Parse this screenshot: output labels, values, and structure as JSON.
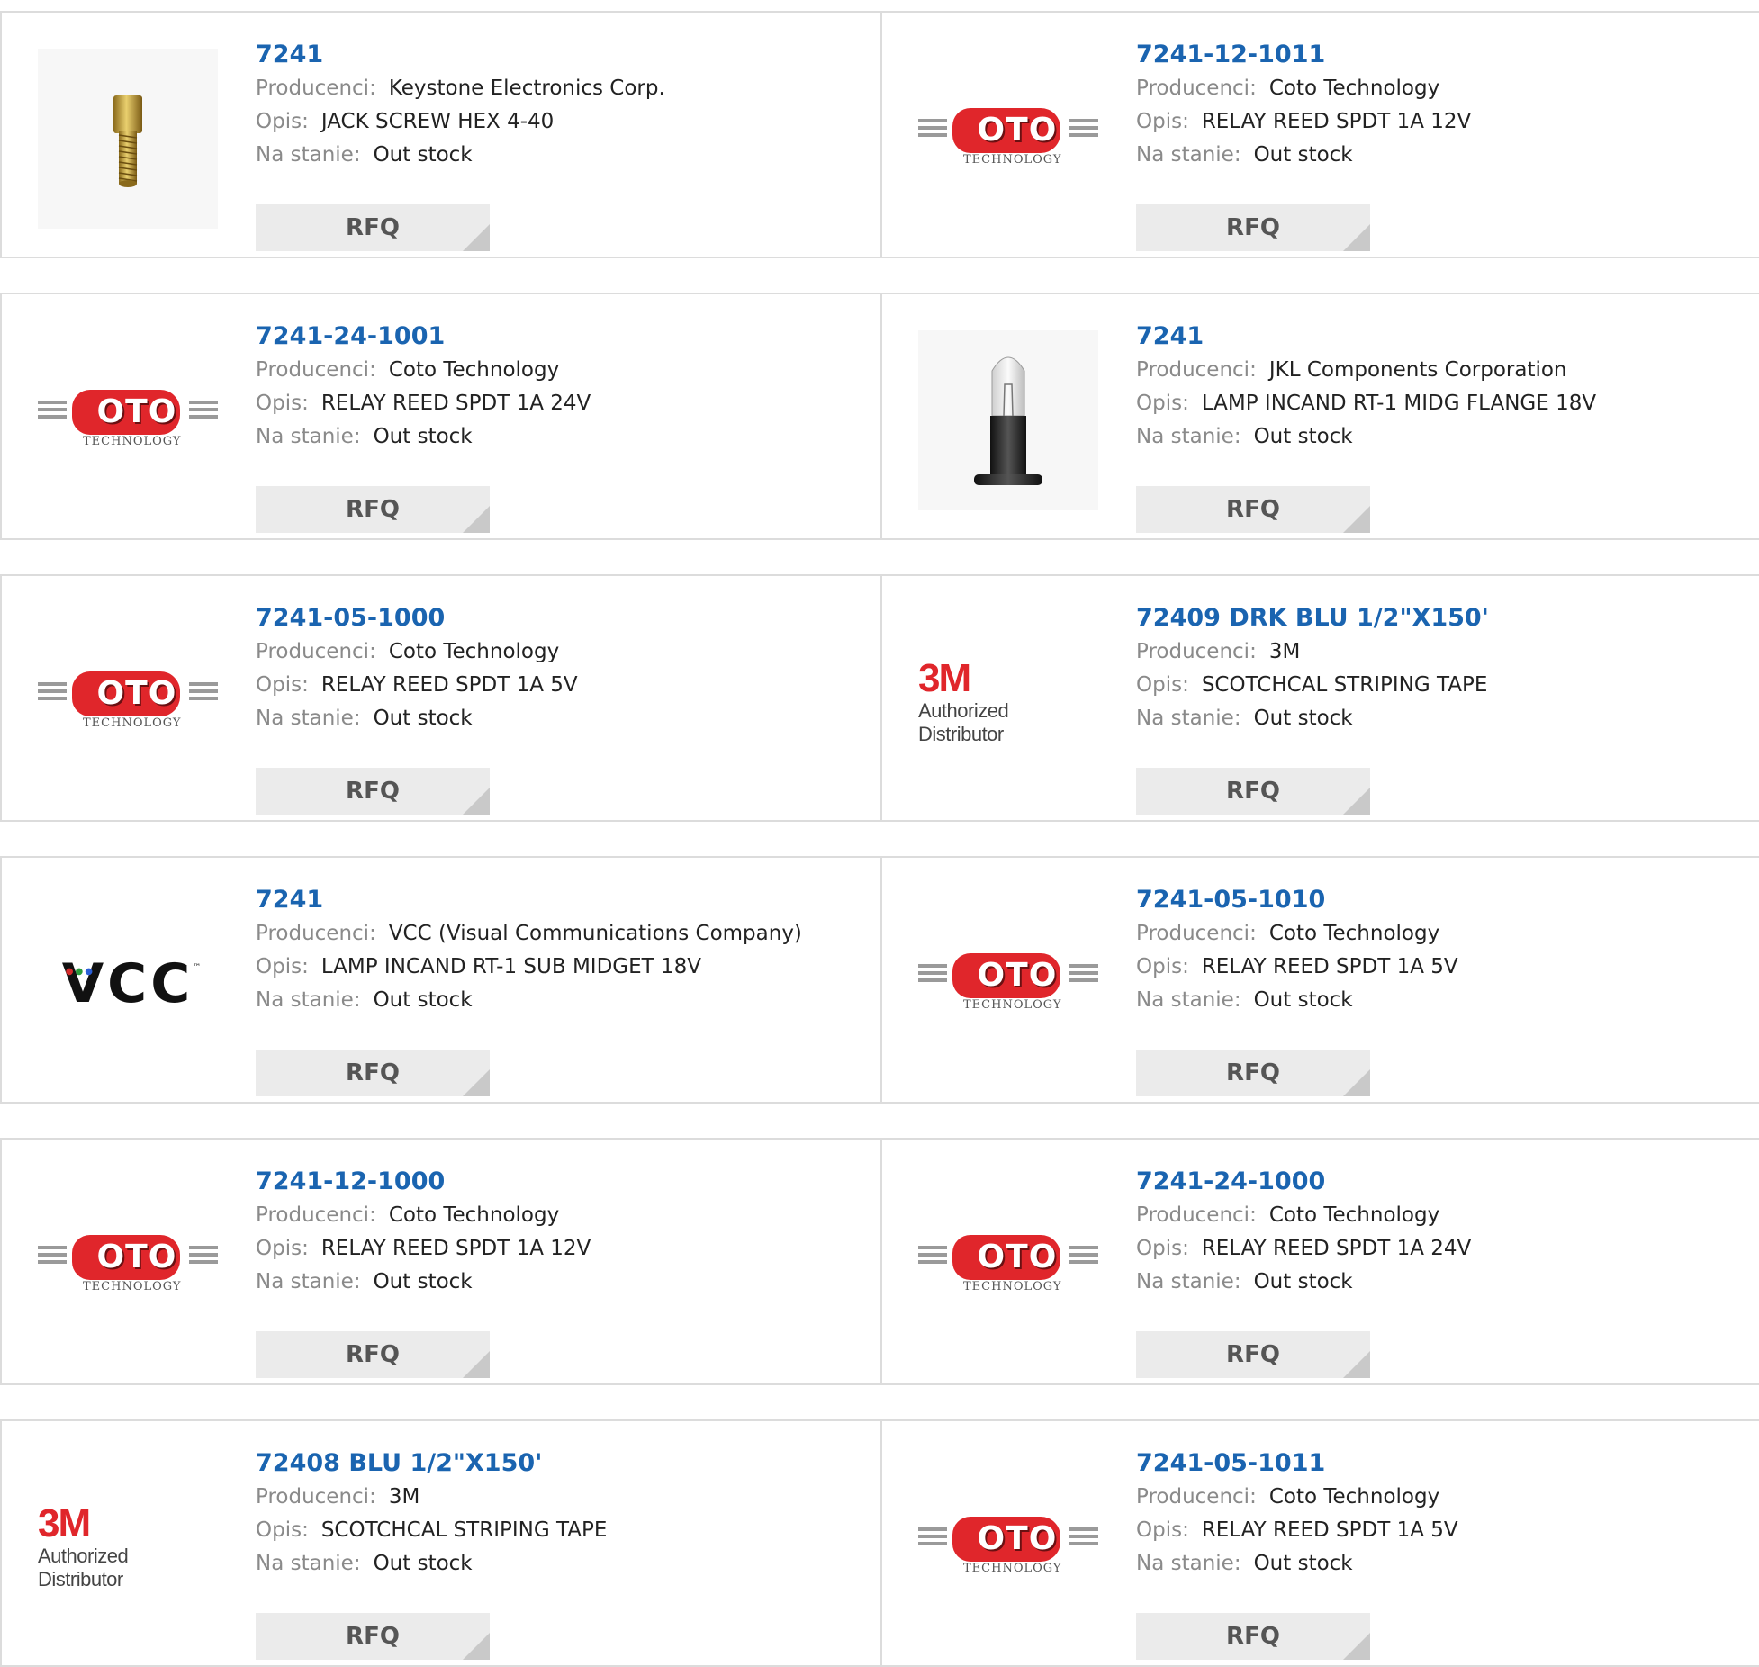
{
  "labels": {
    "manufacturer": "Producenci:",
    "description": "Opis:",
    "stock": "Na stanie:",
    "rfq": "RFQ"
  },
  "products": [
    {
      "part": "7241",
      "manufacturer": "Keystone Electronics Corp.",
      "description": "JACK SCREW HEX 4-40",
      "stock": "Out stock",
      "image": "screw"
    },
    {
      "part": "7241-12-1011",
      "manufacturer": "Coto Technology",
      "description": "RELAY REED SPDT 1A 12V",
      "stock": "Out stock",
      "image": "coto"
    },
    {
      "part": "7241-24-1001",
      "manufacturer": "Coto Technology",
      "description": "RELAY REED SPDT 1A 24V",
      "stock": "Out stock",
      "image": "coto"
    },
    {
      "part": "7241",
      "manufacturer": "JKL Components Corporation",
      "description": "LAMP INCAND RT-1 MIDG FLANGE 18V",
      "stock": "Out stock",
      "image": "lamp"
    },
    {
      "part": "7241-05-1000",
      "manufacturer": "Coto Technology",
      "description": "RELAY REED SPDT 1A 5V",
      "stock": "Out stock",
      "image": "coto"
    },
    {
      "part": "72409 DRK BLU 1/2\"X150'",
      "manufacturer": "3M",
      "description": "SCOTCHCAL STRIPING TAPE",
      "stock": "Out stock",
      "image": "3m"
    },
    {
      "part": "7241",
      "manufacturer": "VCC (Visual Communications Company)",
      "description": "LAMP INCAND RT-1 SUB MIDGET 18V",
      "stock": "Out stock",
      "image": "vcc"
    },
    {
      "part": "7241-05-1010",
      "manufacturer": "Coto Technology",
      "description": "RELAY REED SPDT 1A 5V",
      "stock": "Out stock",
      "image": "coto"
    },
    {
      "part": "7241-12-1000",
      "manufacturer": "Coto Technology",
      "description": "RELAY REED SPDT 1A 12V",
      "stock": "Out stock",
      "image": "coto"
    },
    {
      "part": "7241-24-1000",
      "manufacturer": "Coto Technology",
      "description": "RELAY REED SPDT 1A 24V",
      "stock": "Out stock",
      "image": "coto"
    },
    {
      "part": "72408 BLU 1/2\"X150'",
      "manufacturer": "3M",
      "description": "SCOTCHCAL STRIPING TAPE",
      "stock": "Out stock",
      "image": "3m"
    },
    {
      "part": "7241-05-1011",
      "manufacturer": "Coto Technology",
      "description": "RELAY REED SPDT 1A 5V",
      "stock": "Out stock",
      "image": "coto"
    }
  ],
  "logos": {
    "coto_word": "OTO",
    "coto_tech": "TECHNOLOGY",
    "m3_big": "3M",
    "m3_sub": "Authorized Distributor",
    "vcc_word": "VCC"
  },
  "colors": {
    "part_link": "#1a64b0",
    "label": "#8a8a8a",
    "rfq_bg": "#ebebeb",
    "border": "#dcdcdc",
    "brand_red": "#e0262b"
  }
}
